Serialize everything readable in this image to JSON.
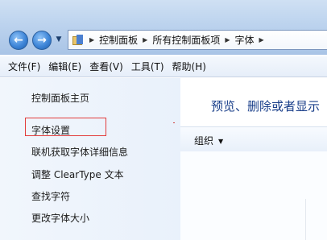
{
  "address": {
    "crumbs": [
      "控制面板",
      "所有控制面板项",
      "字体"
    ]
  },
  "menu": {
    "items": [
      "文件(F)",
      "编辑(E)",
      "查看(V)",
      "工具(T)",
      "帮助(H)"
    ]
  },
  "nav": {
    "home": "控制面板主页",
    "links": [
      "字体设置",
      "联机获取字体详细信息",
      "调整 ClearType 文本",
      "查找字符",
      "更改字体大小"
    ],
    "highlighted_link": "字体设置",
    "highlight_color": "#e23b3b"
  },
  "main": {
    "heading": "预览、删除或者显示",
    "toolbar": {
      "organize": "组织"
    }
  },
  "icons": {
    "back": "back-arrow-icon",
    "forward": "forward-arrow-icon",
    "history": "chevron-down-icon",
    "address": "control-panel-fonts-icon",
    "separator": "breadcrumb-arrow-icon"
  }
}
